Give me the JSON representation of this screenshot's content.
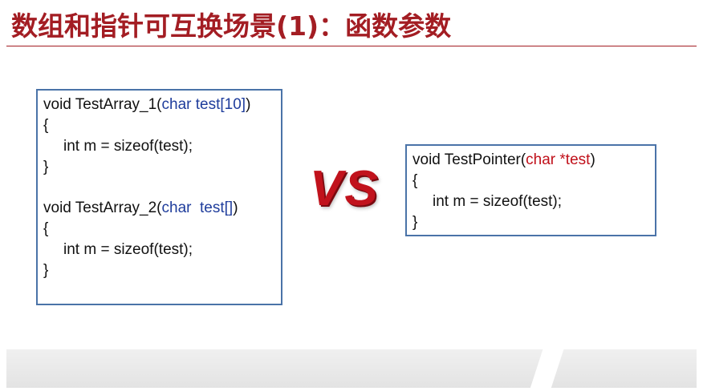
{
  "title": "数组和指针可互换场景(1)：函数参数",
  "vs_label": "VS",
  "left_code": {
    "func1": {
      "prefix": "void TestArray_1(",
      "param": "char test[10]",
      "suffix": ")"
    },
    "brace_open_1": "{",
    "body1": "int m = sizeof(test);",
    "brace_close_1": "}",
    "func2": {
      "prefix": "void TestArray_2(",
      "param": "char  test[]",
      "suffix": ")"
    },
    "brace_open_2": "{",
    "body2": "int m = sizeof(test);",
    "brace_close_2": "}"
  },
  "right_code": {
    "func": {
      "prefix": "void TestPointer(",
      "param": "char *test",
      "suffix": ")"
    },
    "brace_open": "{",
    "body": "int m = sizeof(test);",
    "brace_close": "}"
  },
  "colors": {
    "title": "#a31d23",
    "param_blue": "#1f3d9c",
    "param_red": "#c0101a",
    "box_border": "#4a73a8",
    "vs": "#c1121c"
  }
}
